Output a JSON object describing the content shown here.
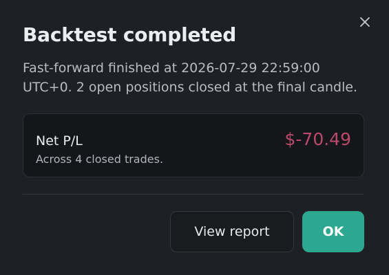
{
  "dialog": {
    "title": "Backtest completed",
    "description": "Fast-forward finished at 2026-07-29 22:59:00 UTC+0. 2 open positions closed at the final candle.",
    "close_icon": "close-icon"
  },
  "summary": {
    "label": "Net P/L",
    "subtext": "Across 4 closed trades.",
    "value": "$-70.49",
    "value_color": "#b94a6b"
  },
  "actions": {
    "view_report_label": "View report",
    "ok_label": "OK",
    "primary_color": "#2da890"
  }
}
